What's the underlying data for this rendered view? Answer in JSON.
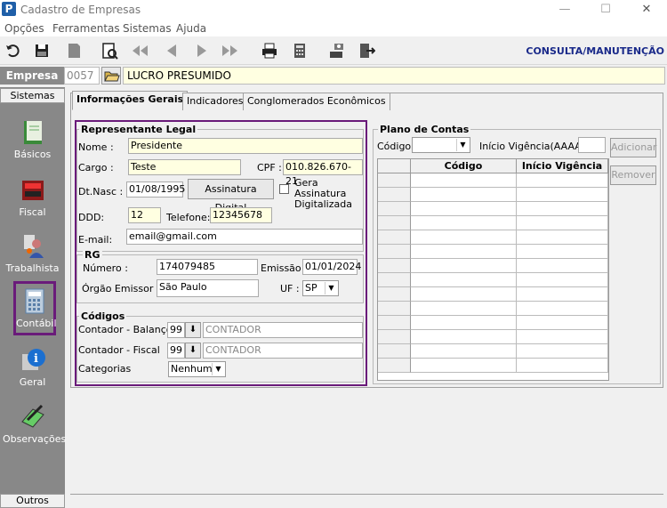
{
  "window": {
    "title": "Cadastro de Empresas",
    "app_icon": "P",
    "minimize": "—",
    "maximize": "☐",
    "close": "✕"
  },
  "menu": [
    "Opções",
    "Ferramentas",
    "Sistemas",
    "Ajuda"
  ],
  "toolbar": {
    "mode_label": "CONSULTA/MANUTENÇÃO",
    "icons": [
      "undo-icon",
      "save-icon",
      "bookmark-icon",
      "preview-icon",
      "first-icon",
      "prev-icon",
      "next-icon",
      "last-icon",
      "print-icon",
      "calculator-icon",
      "tools-icon",
      "exit-icon"
    ]
  },
  "empresa": {
    "label": "Empresa",
    "code": "0057",
    "name": "LUCRO PRESUMIDO"
  },
  "sidebar": {
    "header": "Sistemas",
    "footer": "Outros",
    "items": [
      {
        "label": "Básicos",
        "icon": "book-icon"
      },
      {
        "label": "Fiscal",
        "icon": "fiscal-book-icon"
      },
      {
        "label": "Trabalhista",
        "icon": "worker-icon"
      },
      {
        "label": "Contábil",
        "icon": "calculator-icon"
      },
      {
        "label": "Geral",
        "icon": "info-icon"
      },
      {
        "label": "Observações",
        "icon": "pen-icon"
      }
    ]
  },
  "tabs": [
    "Informações Gerais",
    "Indicadores",
    "Conglomerados Econômicos"
  ],
  "representante": {
    "title": "Representante Legal",
    "nome_label": "Nome :",
    "nome": "Presidente",
    "cargo_label": "Cargo :",
    "cargo": "Teste",
    "cpf_label": "CPF :",
    "cpf": "010.826.670-21",
    "dtnasc_label": "Dt.Nasc :",
    "dtnasc": "01/08/1995",
    "assinatura_button": "Assinatura Digital",
    "gera_assinatura": "Gera Assinatura Digitalizada",
    "ddd_label": "DDD:",
    "ddd": "12",
    "telefone_label": "Telefone:",
    "telefone": "12345678",
    "email_label": "E-mail:",
    "email": "email@gmail.com"
  },
  "rg": {
    "title": "RG",
    "numero_label": "Número :",
    "numero": "174079485",
    "emissao_label": "Emissão :",
    "emissao": "01/01/2024",
    "orgao_label": "Órgão Emissor :",
    "orgao": "São Paulo",
    "uf_label": "UF :",
    "uf": "SP"
  },
  "codigos": {
    "title": "Códigos",
    "contador_balanco_label": "Contador - Balanço",
    "contador_balanco_code": "99",
    "contador_balanco_name": "CONTADOR",
    "contador_fiscal_label": "Contador - Fiscal",
    "contador_fiscal_code": "99",
    "contador_fiscal_name": "CONTADOR",
    "categorias_label": "Categorias",
    "categorias": "Nenhum"
  },
  "plano": {
    "title": "Plano de Contas",
    "codigo_label": "Código:",
    "codigo": "",
    "inicio_label": "Início Vigência(AAAA):",
    "inicio": "",
    "adicionar": "Adicionar",
    "remover": "Remover",
    "columns": [
      "Código",
      "Início Vigência"
    ]
  },
  "colors": {
    "accent_border": "#6a1b7a",
    "field_bg": "#ffffe1",
    "mode_label": "#1a2a8a"
  }
}
